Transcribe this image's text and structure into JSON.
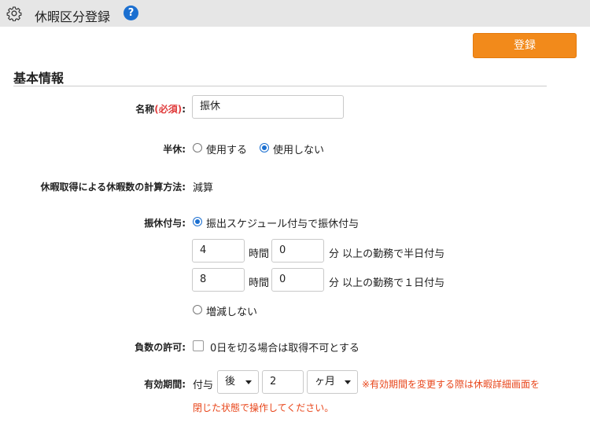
{
  "header": {
    "title": "休暇区分登録",
    "help_label": "?"
  },
  "toolbar": {
    "save_label": "登録"
  },
  "section": {
    "title": "基本情報"
  },
  "form": {
    "name": {
      "label": "名称",
      "required": "(必須)",
      "colon": ":",
      "value": "振休"
    },
    "half": {
      "label": "半休:",
      "options": [
        "使用する",
        "使用しない"
      ],
      "selected": 1
    },
    "calc": {
      "label": "休暇取得による休暇数の計算方法:",
      "value": "減算"
    },
    "grant": {
      "label": "振休付与:",
      "option_schedule": "振出スケジュール付与で振休付与",
      "option_none": "増減しない",
      "selected": "schedule",
      "half_row": {
        "hours": "4",
        "minutes": "0",
        "hours_unit": "時間",
        "suffix": "分 以上の勤務で半日付与"
      },
      "full_row": {
        "hours": "8",
        "minutes": "0",
        "hours_unit": "時間",
        "suffix": "分 以上の勤務で１日付与"
      }
    },
    "negative": {
      "label": "負数の許可:",
      "checkbox_label": "0日を切る場合は取得不可とする",
      "checked": false
    },
    "validity": {
      "label": "有効期間:",
      "prefix": "付与",
      "after_value": "後",
      "number_value": "2",
      "unit_value": "ヶ月",
      "warning_line1": "※有効期間を変更する際は休暇詳細画面を",
      "warning_line2": "閉じた状態で操作してください。"
    }
  },
  "colors": {
    "accent": "#f28a1b",
    "link": "#1b6fd0",
    "warning": "#e8461b"
  }
}
